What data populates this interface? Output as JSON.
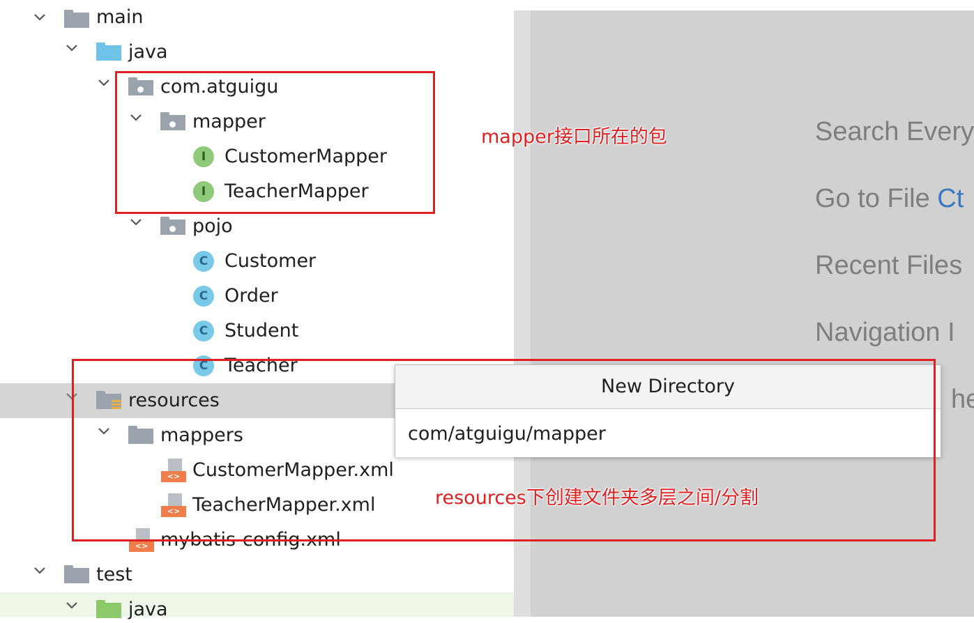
{
  "tree": {
    "rows": [
      {
        "label": "main"
      },
      {
        "label": "java"
      },
      {
        "label": "com.atguigu"
      },
      {
        "label": "mapper"
      },
      {
        "label": "CustomerMapper",
        "badge": "I"
      },
      {
        "label": "TeacherMapper",
        "badge": "I"
      },
      {
        "label": "pojo"
      },
      {
        "label": "Customer",
        "badge": "C"
      },
      {
        "label": "Order",
        "badge": "C"
      },
      {
        "label": "Student",
        "badge": "C"
      },
      {
        "label": "Teacher",
        "badge": "C"
      },
      {
        "label": "resources"
      },
      {
        "label": "mappers"
      },
      {
        "label": "CustomerMapper.xml",
        "badge": "<>"
      },
      {
        "label": "TeacherMapper.xml",
        "badge": "<>"
      },
      {
        "label": "mybatis-config.xml",
        "badge": "<>"
      },
      {
        "label": "test"
      },
      {
        "label": "java"
      }
    ]
  },
  "hints": {
    "search_everywhere": "Search Every",
    "go_to_file": "Go to File",
    "go_to_file_key": "Ct",
    "recent_files": "Recent Files",
    "navigation": "Navigation I",
    "partial": "he"
  },
  "dialog": {
    "title": "New Directory",
    "input_value": "com/atguigu/mapper"
  },
  "annotations": {
    "mapper_note": "mapper接口所在的包",
    "resources_note": "resources下创建文件夹多层之间/分割"
  },
  "colors": {
    "annotation": "#e02020",
    "selection": "#d5d5d5",
    "panel": "#d1d1d1"
  }
}
